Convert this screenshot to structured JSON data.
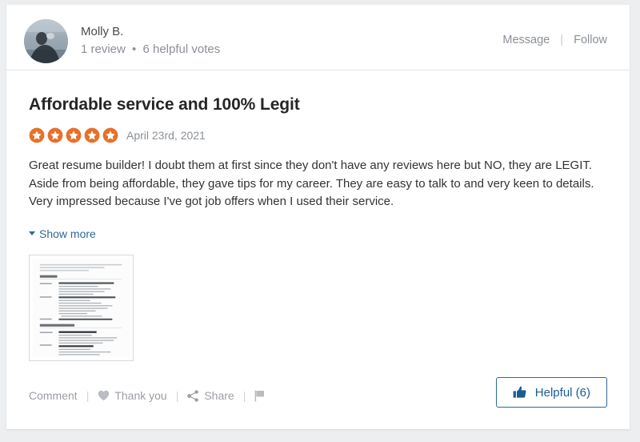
{
  "review": {
    "author": {
      "name": "Molly B.",
      "reviews_count": "1 review",
      "separator": "•",
      "helpful_votes": "6 helpful votes",
      "avatar_alt": "avatar"
    },
    "header_actions": {
      "message": "Message",
      "divider": "|",
      "follow": "Follow"
    },
    "title": "Affordable service and 100% Legit",
    "rating": {
      "value": 5,
      "max": 5,
      "star_color": "#e8702a",
      "star_inner_color": "#ffffff"
    },
    "date": "April 23rd, 2021",
    "body": "Great resume builder! I doubt them at first since they don't have any reviews here but NO, they are LEGIT. Aside from being affordable, they gave tips for my career. They are easy to talk to and very keen to details. Very impressed because I've got job offers when I used their service.",
    "show_more": "Show more",
    "attachment": {
      "type": "document-thumbnail",
      "alt": "Attached resume document preview"
    },
    "footer": {
      "comment": "Comment",
      "thank_you": "Thank you",
      "share": "Share",
      "pipe": "|",
      "flag_icon": "flag-icon",
      "heart_icon": "heart-icon",
      "share_icon": "share-icon"
    },
    "helpful_button": {
      "label": "Helpful (6)",
      "icon": "thumbs-up-icon",
      "accent_color": "#2b6a9b"
    }
  }
}
